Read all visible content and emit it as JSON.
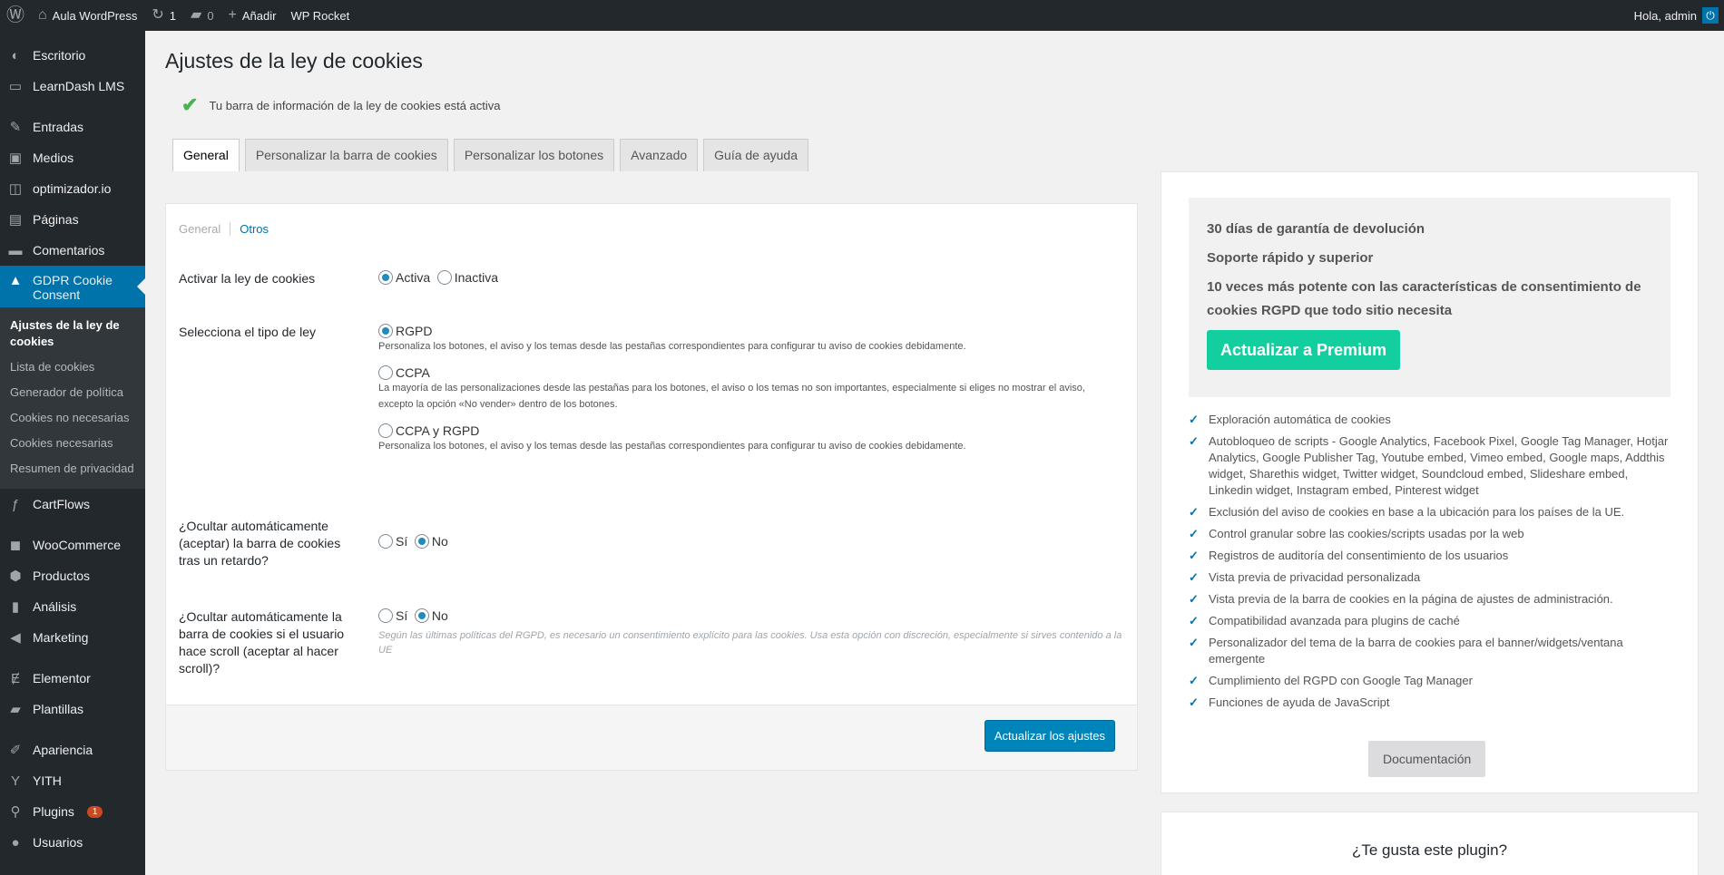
{
  "adminbar": {
    "site": "Aula WordPress",
    "updates": "1",
    "comments": "0",
    "add": "Añadir",
    "rocket": "WP Rocket",
    "greeting": "Hola, admin"
  },
  "sidebar": {
    "items_top": [
      {
        "icon": "dashboard-icon",
        "glyph": "◐",
        "label": "Escritorio"
      },
      {
        "icon": "learndash-icon",
        "glyph": "▭",
        "label": "LearnDash LMS"
      }
    ],
    "items_mid": [
      {
        "icon": "pin-icon",
        "glyph": "✎",
        "label": "Entradas"
      },
      {
        "icon": "media-icon",
        "glyph": "▣",
        "label": "Medios"
      },
      {
        "icon": "optimizer-icon",
        "glyph": "◫",
        "label": "optimizador.io"
      },
      {
        "icon": "pages-icon",
        "glyph": "▤",
        "label": "Páginas"
      },
      {
        "icon": "comments-icon",
        "glyph": "▬",
        "label": "Comentarios"
      }
    ],
    "active": {
      "icon": "lock-icon",
      "glyph": "🔒",
      "label_line1": "GDPR Cookie",
      "label_line2": "Consent"
    },
    "submenu": [
      "Ajustes de la ley de cookies",
      "Lista de cookies",
      "Generador de política",
      "Cookies no necesarias",
      "Cookies necesarias",
      "Resumen de privacidad"
    ],
    "items_after": [
      {
        "icon": "cartflows-icon",
        "glyph": "ƒ",
        "label": "CartFlows"
      }
    ],
    "items_woo": [
      {
        "icon": "woo-icon",
        "glyph": "◼",
        "label": "WooCommerce"
      },
      {
        "icon": "products-icon",
        "glyph": "⬢",
        "label": "Productos"
      },
      {
        "icon": "analytics-icon",
        "glyph": "▮",
        "label": "Análisis"
      },
      {
        "icon": "marketing-icon",
        "glyph": "◀",
        "label": "Marketing"
      }
    ],
    "items_el": [
      {
        "icon": "elementor-icon",
        "glyph": "Ɇ",
        "label": "Elementor"
      },
      {
        "icon": "templates-icon",
        "glyph": "▰",
        "label": "Plantillas"
      }
    ],
    "items_bottom": [
      {
        "icon": "appearance-icon",
        "glyph": "✐",
        "label": "Apariencia"
      },
      {
        "icon": "yith-icon",
        "glyph": "Y",
        "label": "YITH"
      },
      {
        "icon": "plugins-icon",
        "glyph": "⚲",
        "label": "Plugins",
        "badge": "1"
      },
      {
        "icon": "users-icon",
        "glyph": "●",
        "label": "Usuarios"
      }
    ]
  },
  "page": {
    "title": "Ajustes de la ley de cookies",
    "notice": "Tu barra de información de la ley de cookies está activa"
  },
  "tabs": [
    "General",
    "Personalizar la barra de cookies",
    "Personalizar los botones",
    "Avanzado",
    "Guía de ayuda"
  ],
  "subnav": {
    "general": "General",
    "otros": "Otros"
  },
  "form": {
    "activar": {
      "label": "Activar la ley de cookies",
      "on": "Activa",
      "off": "Inactiva"
    },
    "tipo": {
      "label": "Selecciona el tipo de ley",
      "rgpd": "RGPD",
      "rgpd_desc": "Personaliza los botones, el aviso y los temas desde las pestañas correspondientes para configurar tu aviso de cookies debidamente.",
      "ccpa": "CCPA",
      "ccpa_desc": "La mayoría de las personalizaciones desde las pestañas para los botones, el aviso o los temas no son importantes, especialmente si eliges no mostrar el aviso, excepto la opción «No vender» dentro de los botones.",
      "both": "CCPA y RGPD",
      "both_desc": "Personaliza los botones, el aviso y los temas desde las pestañas correspondientes para configurar tu aviso de cookies debidamente."
    },
    "retardo": {
      "label": "¿Ocultar automáticamente (aceptar) la barra de cookies tras un retardo?",
      "yes": "Sí",
      "no": "No"
    },
    "scroll": {
      "label": "¿Ocultar automáticamente la barra de cookies si el usuario hace scroll (aceptar al hacer scroll)?",
      "yes": "Sí",
      "no": "No",
      "desc": "Según las últimas políticas del RGPD, es necesario un consentimiento explícito para las cookies. Usa esta opción con discreción, especialmente si sirves contenido a la UE"
    },
    "submit": "Actualizar los ajustes"
  },
  "aside": {
    "promo": [
      "30 días de garantía de devolución",
      "Soporte rápido y superior",
      "10 veces más potente con las características de consentimiento de cookies RGPD que todo sitio necesita"
    ],
    "premium": "Actualizar a Premium",
    "features": [
      "Exploración automática de cookies",
      "Autobloqueo de scripts - Google Analytics, Facebook Pixel, Google Tag Manager, Hotjar Analytics, Google Publisher Tag, Youtube embed, Vimeo embed, Google maps, Addthis widget, Sharethis widget, Twitter widget, Soundcloud embed, Slideshare embed, Linkedin widget, Instagram embed, Pinterest widget",
      "Exclusión del aviso de cookies en base a la ubicación para los países de la UE.",
      "Control granular sobre las cookies/scripts usadas por la web",
      "Registros de auditoría del consentimiento de los usuarios",
      "Vista previa de privacidad personalizada",
      "Vista previa de la barra de cookies en la página de ajustes de administración.",
      "Compatibilidad avanzada para plugins de caché",
      "Personalizador del tema de la barra de cookies para el banner/widgets/ventana emergente",
      "Cumplimiento del RGPD con Google Tag Manager",
      "Funciones de ayuda de JavaScript"
    ],
    "docs": "Documentación",
    "like": "¿Te gusta este plugin?"
  }
}
